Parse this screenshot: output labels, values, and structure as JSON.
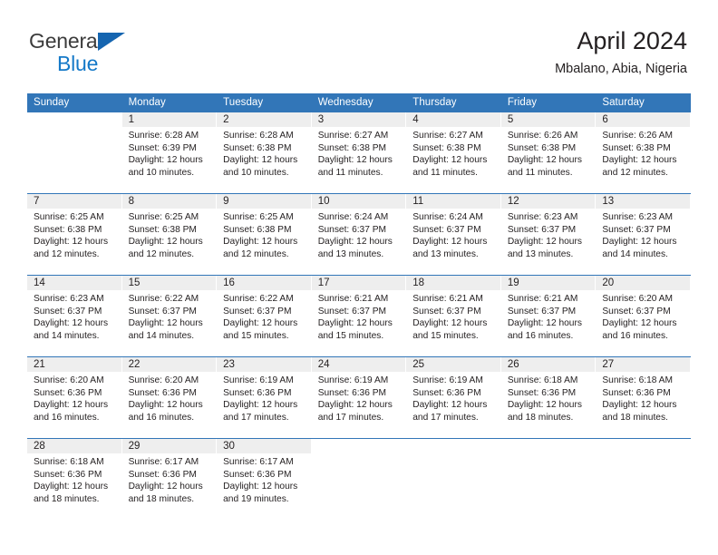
{
  "brand": {
    "line1": "General",
    "line2": "Blue",
    "flag_icon": "triangle-flag-icon",
    "accent_dark": "#1565b0",
    "accent_light": "#1579c8"
  },
  "header": {
    "title": "April 2024",
    "subtitle": "Mbalano, Abia, Nigeria"
  },
  "colors": {
    "header_band": "#3276b8",
    "daynum_band": "#eeeeee",
    "text": "#231f20"
  },
  "weekday_headers": [
    "Sunday",
    "Monday",
    "Tuesday",
    "Wednesday",
    "Thursday",
    "Friday",
    "Saturday"
  ],
  "labels": {
    "sunrise_prefix": "Sunrise:",
    "sunset_prefix": "Sunset:",
    "daylight_prefix": "Daylight:"
  },
  "weeks": [
    [
      {
        "day": "",
        "sunrise": "",
        "sunset": "",
        "daylight_line1": "",
        "daylight_line2": "",
        "empty": true
      },
      {
        "day": "1",
        "sunrise": "Sunrise: 6:28 AM",
        "sunset": "Sunset: 6:39 PM",
        "daylight_line1": "Daylight: 12 hours",
        "daylight_line2": "and 10 minutes.",
        "empty": false
      },
      {
        "day": "2",
        "sunrise": "Sunrise: 6:28 AM",
        "sunset": "Sunset: 6:38 PM",
        "daylight_line1": "Daylight: 12 hours",
        "daylight_line2": "and 10 minutes.",
        "empty": false
      },
      {
        "day": "3",
        "sunrise": "Sunrise: 6:27 AM",
        "sunset": "Sunset: 6:38 PM",
        "daylight_line1": "Daylight: 12 hours",
        "daylight_line2": "and 11 minutes.",
        "empty": false
      },
      {
        "day": "4",
        "sunrise": "Sunrise: 6:27 AM",
        "sunset": "Sunset: 6:38 PM",
        "daylight_line1": "Daylight: 12 hours",
        "daylight_line2": "and 11 minutes.",
        "empty": false
      },
      {
        "day": "5",
        "sunrise": "Sunrise: 6:26 AM",
        "sunset": "Sunset: 6:38 PM",
        "daylight_line1": "Daylight: 12 hours",
        "daylight_line2": "and 11 minutes.",
        "empty": false
      },
      {
        "day": "6",
        "sunrise": "Sunrise: 6:26 AM",
        "sunset": "Sunset: 6:38 PM",
        "daylight_line1": "Daylight: 12 hours",
        "daylight_line2": "and 12 minutes.",
        "empty": false
      }
    ],
    [
      {
        "day": "7",
        "sunrise": "Sunrise: 6:25 AM",
        "sunset": "Sunset: 6:38 PM",
        "daylight_line1": "Daylight: 12 hours",
        "daylight_line2": "and 12 minutes.",
        "empty": false
      },
      {
        "day": "8",
        "sunrise": "Sunrise: 6:25 AM",
        "sunset": "Sunset: 6:38 PM",
        "daylight_line1": "Daylight: 12 hours",
        "daylight_line2": "and 12 minutes.",
        "empty": false
      },
      {
        "day": "9",
        "sunrise": "Sunrise: 6:25 AM",
        "sunset": "Sunset: 6:38 PM",
        "daylight_line1": "Daylight: 12 hours",
        "daylight_line2": "and 12 minutes.",
        "empty": false
      },
      {
        "day": "10",
        "sunrise": "Sunrise: 6:24 AM",
        "sunset": "Sunset: 6:37 PM",
        "daylight_line1": "Daylight: 12 hours",
        "daylight_line2": "and 13 minutes.",
        "empty": false
      },
      {
        "day": "11",
        "sunrise": "Sunrise: 6:24 AM",
        "sunset": "Sunset: 6:37 PM",
        "daylight_line1": "Daylight: 12 hours",
        "daylight_line2": "and 13 minutes.",
        "empty": false
      },
      {
        "day": "12",
        "sunrise": "Sunrise: 6:23 AM",
        "sunset": "Sunset: 6:37 PM",
        "daylight_line1": "Daylight: 12 hours",
        "daylight_line2": "and 13 minutes.",
        "empty": false
      },
      {
        "day": "13",
        "sunrise": "Sunrise: 6:23 AM",
        "sunset": "Sunset: 6:37 PM",
        "daylight_line1": "Daylight: 12 hours",
        "daylight_line2": "and 14 minutes.",
        "empty": false
      }
    ],
    [
      {
        "day": "14",
        "sunrise": "Sunrise: 6:23 AM",
        "sunset": "Sunset: 6:37 PM",
        "daylight_line1": "Daylight: 12 hours",
        "daylight_line2": "and 14 minutes.",
        "empty": false
      },
      {
        "day": "15",
        "sunrise": "Sunrise: 6:22 AM",
        "sunset": "Sunset: 6:37 PM",
        "daylight_line1": "Daylight: 12 hours",
        "daylight_line2": "and 14 minutes.",
        "empty": false
      },
      {
        "day": "16",
        "sunrise": "Sunrise: 6:22 AM",
        "sunset": "Sunset: 6:37 PM",
        "daylight_line1": "Daylight: 12 hours",
        "daylight_line2": "and 15 minutes.",
        "empty": false
      },
      {
        "day": "17",
        "sunrise": "Sunrise: 6:21 AM",
        "sunset": "Sunset: 6:37 PM",
        "daylight_line1": "Daylight: 12 hours",
        "daylight_line2": "and 15 minutes.",
        "empty": false
      },
      {
        "day": "18",
        "sunrise": "Sunrise: 6:21 AM",
        "sunset": "Sunset: 6:37 PM",
        "daylight_line1": "Daylight: 12 hours",
        "daylight_line2": "and 15 minutes.",
        "empty": false
      },
      {
        "day": "19",
        "sunrise": "Sunrise: 6:21 AM",
        "sunset": "Sunset: 6:37 PM",
        "daylight_line1": "Daylight: 12 hours",
        "daylight_line2": "and 16 minutes.",
        "empty": false
      },
      {
        "day": "20",
        "sunrise": "Sunrise: 6:20 AM",
        "sunset": "Sunset: 6:37 PM",
        "daylight_line1": "Daylight: 12 hours",
        "daylight_line2": "and 16 minutes.",
        "empty": false
      }
    ],
    [
      {
        "day": "21",
        "sunrise": "Sunrise: 6:20 AM",
        "sunset": "Sunset: 6:36 PM",
        "daylight_line1": "Daylight: 12 hours",
        "daylight_line2": "and 16 minutes.",
        "empty": false
      },
      {
        "day": "22",
        "sunrise": "Sunrise: 6:20 AM",
        "sunset": "Sunset: 6:36 PM",
        "daylight_line1": "Daylight: 12 hours",
        "daylight_line2": "and 16 minutes.",
        "empty": false
      },
      {
        "day": "23",
        "sunrise": "Sunrise: 6:19 AM",
        "sunset": "Sunset: 6:36 PM",
        "daylight_line1": "Daylight: 12 hours",
        "daylight_line2": "and 17 minutes.",
        "empty": false
      },
      {
        "day": "24",
        "sunrise": "Sunrise: 6:19 AM",
        "sunset": "Sunset: 6:36 PM",
        "daylight_line1": "Daylight: 12 hours",
        "daylight_line2": "and 17 minutes.",
        "empty": false
      },
      {
        "day": "25",
        "sunrise": "Sunrise: 6:19 AM",
        "sunset": "Sunset: 6:36 PM",
        "daylight_line1": "Daylight: 12 hours",
        "daylight_line2": "and 17 minutes.",
        "empty": false
      },
      {
        "day": "26",
        "sunrise": "Sunrise: 6:18 AM",
        "sunset": "Sunset: 6:36 PM",
        "daylight_line1": "Daylight: 12 hours",
        "daylight_line2": "and 18 minutes.",
        "empty": false
      },
      {
        "day": "27",
        "sunrise": "Sunrise: 6:18 AM",
        "sunset": "Sunset: 6:36 PM",
        "daylight_line1": "Daylight: 12 hours",
        "daylight_line2": "and 18 minutes.",
        "empty": false
      }
    ],
    [
      {
        "day": "28",
        "sunrise": "Sunrise: 6:18 AM",
        "sunset": "Sunset: 6:36 PM",
        "daylight_line1": "Daylight: 12 hours",
        "daylight_line2": "and 18 minutes.",
        "empty": false
      },
      {
        "day": "29",
        "sunrise": "Sunrise: 6:17 AM",
        "sunset": "Sunset: 6:36 PM",
        "daylight_line1": "Daylight: 12 hours",
        "daylight_line2": "and 18 minutes.",
        "empty": false
      },
      {
        "day": "30",
        "sunrise": "Sunrise: 6:17 AM",
        "sunset": "Sunset: 6:36 PM",
        "daylight_line1": "Daylight: 12 hours",
        "daylight_line2": "and 19 minutes.",
        "empty": false
      },
      {
        "day": "",
        "sunrise": "",
        "sunset": "",
        "daylight_line1": "",
        "daylight_line2": "",
        "empty": true
      },
      {
        "day": "",
        "sunrise": "",
        "sunset": "",
        "daylight_line1": "",
        "daylight_line2": "",
        "empty": true
      },
      {
        "day": "",
        "sunrise": "",
        "sunset": "",
        "daylight_line1": "",
        "daylight_line2": "",
        "empty": true
      },
      {
        "day": "",
        "sunrise": "",
        "sunset": "",
        "daylight_line1": "",
        "daylight_line2": "",
        "empty": true
      }
    ]
  ]
}
